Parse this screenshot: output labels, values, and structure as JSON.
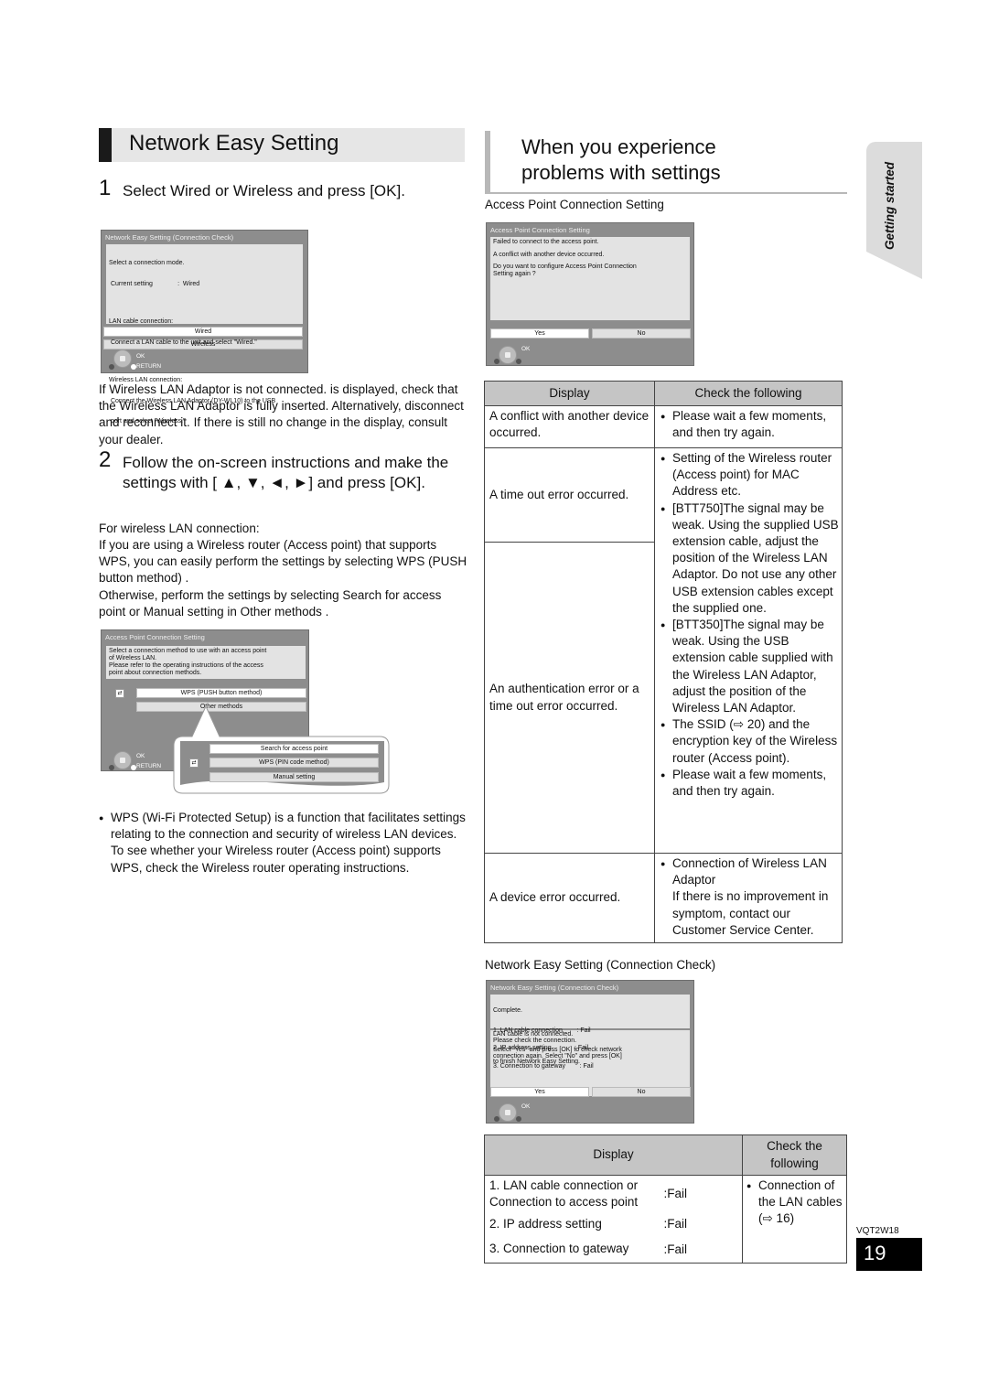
{
  "left": {
    "heading": "Network Easy Setting",
    "step1": {
      "num": "1",
      "text": "Select  Wired  or  Wireless  and press [OK]."
    },
    "osd1": {
      "title": "Network Easy Setting (Connection Check)",
      "lines": [
        "Select a connection mode.",
        " Current setting              :  Wired",
        "",
        "LAN cable connection:",
        " Connect a LAN cable to the unit and select \"Wired.\"",
        "",
        "Wireless LAN connection:",
        " Connect the Wireless LAN Adaptor (DY-WL10) to the USB",
        " port and select \"Wireless.\""
      ],
      "buttons": [
        "Wired",
        "Wireless"
      ],
      "nav_ok": "OK",
      "nav_return": "RETURN"
    },
    "note": "If  Wireless LAN Adaptor is not connected.  is displayed, check that the Wireless LAN Adaptor is fully inserted. Alternatively, disconnect and reconnect it. If there is still no change in the display, consult your dealer.",
    "step2": {
      "num": "2",
      "text": "Follow the on-screen instructions and make the settings with [   ▲, ▼, ◄, ►] and press [OK]."
    },
    "wireless_label": "For wireless LAN connection:",
    "wireless_text": "If you are using a Wireless router (Access point) that supports WPS, you can easily perform the settings by selecting  WPS (PUSH button method) .\nOtherwise, perform the settings by selecting  Search for access point  or  Manual setting  in  Other methods .",
    "osd2": {
      "title": "Access Point Connection Setting",
      "lines": [
        "Select a connection method to use with an access point",
        "of Wireless LAN.",
        "Please refer to the operating instructions of the access",
        "point about connection methods."
      ],
      "buttons": [
        "WPS (PUSH button method)",
        "Other methods"
      ],
      "popup_buttons": [
        "Search for access point",
        "WPS (PIN code method)",
        "Manual setting"
      ],
      "nav_ok": "OK",
      "nav_return": "RETURN"
    },
    "wps_note": "WPS (Wi-Fi Protected Setup) is a function that facilitates settings relating to the connection and security of wireless LAN devices. To see whether your Wireless router (Access point) supports WPS, check the Wireless router operating instructions."
  },
  "right": {
    "heading_line1": "When you experience",
    "heading_line2": "problems with settings",
    "caption1": "Access Point Connection Setting",
    "osd3": {
      "title": "Access Point Connection Setting",
      "lines": [
        "Failed to connect to the access point.",
        "",
        "A conflict with another device occurred.",
        "",
        "Do you want to configure Access Point Connection",
        "Setting again ?"
      ],
      "buttons": [
        "Yes",
        "No"
      ],
      "nav_ok": "OK"
    },
    "table1": {
      "headers": [
        "Display",
        "Check the following"
      ],
      "rows": [
        {
          "display": "A conflict with another device occurred.",
          "checks": [
            "Please wait a few moments, and then try again."
          ]
        },
        {
          "display": "A time out error occurred.",
          "checks": [
            "Setting of the Wireless router (Access point) for MAC Address etc.",
            "[BTT750]The signal may be weak. Using the supplied USB extension cable, adjust the position of the Wireless LAN Adaptor. Do not use any other USB extension cables except the supplied one.",
            "[BTT350]The signal may be weak. Using the USB extension cable supplied with the Wireless LAN Adaptor, adjust the position of the Wireless LAN Adaptor.",
            "The SSID (⇨ 20) and the encryption key of the Wireless router (Access point).",
            "Please wait a few moments, and then try again."
          ]
        },
        {
          "display": "An authentication error or a time out error occurred.",
          "checks": []
        },
        {
          "display": "A device error occurred.",
          "checks": [
            "Connection of Wireless LAN Adaptor"
          ],
          "extra": "If there is no improvement in symptom, contact our Customer Service Center."
        }
      ]
    },
    "caption2": "Network Easy Setting (Connection Check)",
    "osd4": {
      "title": "Network Easy Setting (Connection Check)",
      "lines_top": [
        "Complete.",
        "1. LAN cable connection        : Fail",
        "2. IP address setting             : Fail",
        "3. Connection to gateway        : Fail"
      ],
      "lines_bottom": [
        "LAN cable is not connected.",
        "Please check the connection.",
        "",
        "Select \"Yes\" and press [OK] to check network",
        "connection again. Select \"No\" and press [OK]",
        "to finish Network Easy Setting."
      ],
      "buttons": [
        "Yes",
        "No"
      ],
      "nav_ok": "OK"
    },
    "table2": {
      "headers": [
        "Display",
        "Check the following"
      ],
      "rows": [
        {
          "item": "1. LAN cable connection or Connection to access point",
          "status": ":Fail"
        },
        {
          "item": "2. IP address setting",
          "status": ":Fail"
        },
        {
          "item": "3. Connection to gateway",
          "status": ":Fail"
        }
      ],
      "check": "Connection of the LAN cables (⇨ 16)"
    }
  },
  "side_tab": "Getting started",
  "doc_code": "VQT2W18",
  "page_number": "19"
}
